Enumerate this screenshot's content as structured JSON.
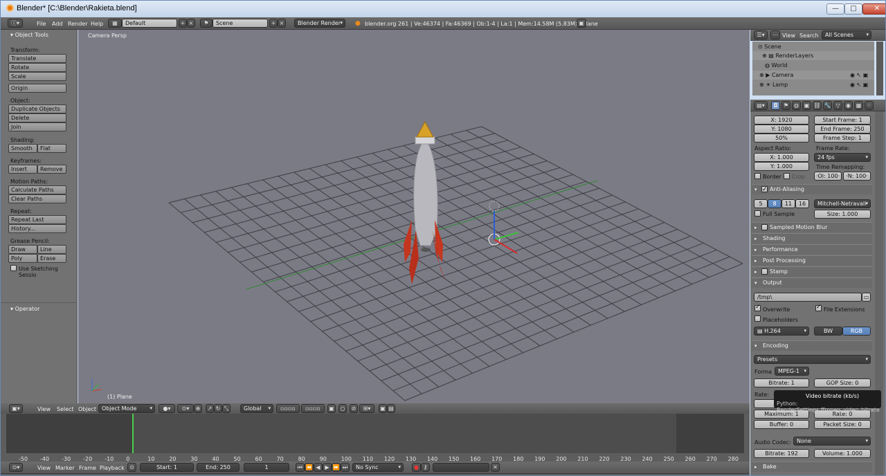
{
  "window": {
    "title": "Blender* [C:\\Blender\\Rakieta.blend]",
    "min": "—",
    "max": "□",
    "close": "✕"
  },
  "info_header": {
    "menus": [
      "File",
      "Add",
      "Render",
      "Help"
    ],
    "layout": "Default",
    "scene": "Scene",
    "engine": "Blender Render",
    "stats": "blender.org 261 | Ve:46374 | Fa:46369 | Ob:1-4 | La:1 | Mem:14.58M (5.83M) | Plane"
  },
  "toolshelf": {
    "title": "Object Tools",
    "sections": [
      {
        "label": "Transform:",
        "buttons": [
          "Translate",
          "Rotate",
          "Scale"
        ]
      },
      {
        "label": "",
        "buttons": [
          "Origin"
        ]
      },
      {
        "label": "Object:",
        "buttons": [
          "Duplicate Objects",
          "Delete",
          "Join"
        ]
      },
      {
        "label": "Shading:",
        "buttons": [
          "Smooth",
          "Flat"
        ]
      },
      {
        "label": "Keyframes:",
        "buttons": [
          "Insert",
          "Remove"
        ]
      },
      {
        "label": "Motion Paths:",
        "buttons": [
          "Calculate Paths",
          "Clear Paths"
        ]
      },
      {
        "label": "Repeat:",
        "buttons": [
          "Repeat Last",
          "History..."
        ]
      },
      {
        "label": "Grease Pencil:",
        "buttons": [
          "Draw",
          "Line",
          "Poly",
          "Erase"
        ]
      }
    ],
    "sketch": "Use Sketching Sessio",
    "operator": "Operator"
  },
  "viewport": {
    "view_name": "Camera Persp",
    "object_label": "(1) Plane"
  },
  "view3d_header": {
    "menus": [
      "View",
      "Select",
      "Object"
    ],
    "mode": "Object Mode",
    "orientation": "Global"
  },
  "timeline": {
    "ticks": [
      "-50",
      "-40",
      "-30",
      "-20",
      "-10",
      "0",
      "10",
      "20",
      "30",
      "40",
      "50",
      "60",
      "70",
      "80",
      "90",
      "100",
      "110",
      "120",
      "130",
      "140",
      "150",
      "160",
      "170",
      "180",
      "190",
      "200",
      "210",
      "220",
      "230",
      "240",
      "250",
      "260",
      "270",
      "280"
    ],
    "menus": [
      "View",
      "Marker",
      "Frame",
      "Playback"
    ],
    "start": "Start: 1",
    "end": "End: 250",
    "current": "1",
    "sync": "No Sync",
    "current_frame": 1
  },
  "outliner": {
    "menus": [
      "View",
      "Search"
    ],
    "filter": "All Scenes",
    "rows": [
      "Scene",
      "RenderLayers",
      "World",
      "Camera",
      "Lamp"
    ]
  },
  "properties": {
    "resolution_x": "X: 1920",
    "resolution_y": "Y: 1080",
    "percent": "50%",
    "start_frame": "Start Frame: 1",
    "end_frame": "End Frame: 250",
    "frame_step": "Frame Step: 1",
    "aspect_label": "Aspect Ratio:",
    "aspect_x": "X: 1.000",
    "aspect_y": "Y: 1.000",
    "framerate_label": "Frame Rate:",
    "framerate": "24 fps",
    "remap_label": "Time Remapping:",
    "remap_old": "·Ol: 100·",
    "remap_new": "·N: 100·",
    "border": "Border",
    "crop": "Crop",
    "aa_title": "Anti-Aliasing",
    "aa_samples": [
      "5",
      "8",
      "11",
      "16"
    ],
    "aa_filter": "Mitchell-Netravali",
    "full_sample": "Full Sample",
    "aa_size": "Size: 1.000",
    "panels": [
      "Sampled Motion Blur",
      "Shading",
      "Performance",
      "Post Processing",
      "Stamp"
    ],
    "output_title": "Output",
    "output_path": "/tmp\\",
    "overwrite": "Overwrite",
    "file_ext": "File Extensions",
    "placeholders": "Placeholders",
    "format": "H.264",
    "bw": "BW",
    "rgb": "RGB",
    "encoding_title": "Encoding",
    "presets": "Presets",
    "forma_label": "Forma",
    "forma": "MPEG-1",
    "bitrate": "Bitrate: 1",
    "gop": "GOP Size: 0",
    "rate_label": "Rate:",
    "minimum": "Mi",
    "maximum": "Maximum: 1",
    "rate": "Rate: 0",
    "buffer": "Buffer: 0",
    "packet": "Packet Size: 0",
    "audio_label": "Audio Codec:",
    "audio": "None",
    "audio_bitrate": "Bitrate: 192",
    "volume": "Volume: 1.000",
    "bake": "Bake"
  },
  "tooltip": {
    "title": "Video bitrate (kb/s)",
    "python": "Python: RenderSettings.ffmpeg_video_bitrate"
  }
}
